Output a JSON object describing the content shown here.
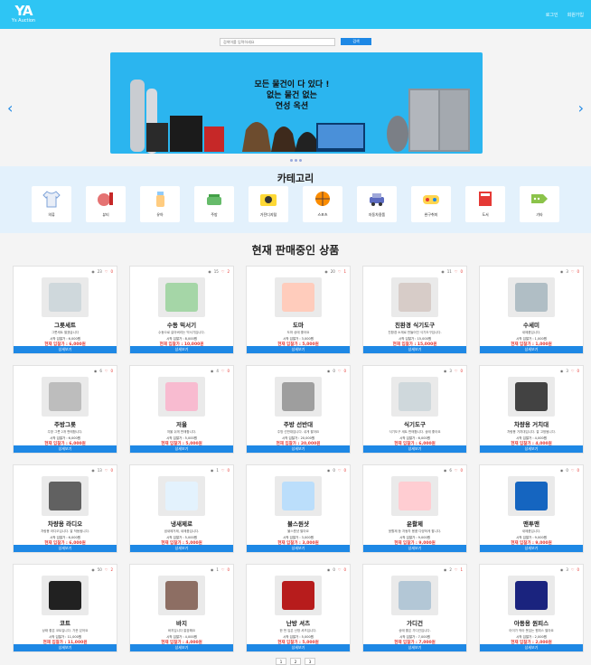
{
  "header": {
    "logo_mark": "YA",
    "logo_text": "Ys Auction",
    "login": "로그인",
    "signup": "회원가입"
  },
  "search": {
    "placeholder": "검색어를 입력하세요",
    "button": "검색"
  },
  "banner": {
    "line1": "모든 물건이 다 있다 !",
    "line2": "없는 물건 없는",
    "line3": "연성 옥션"
  },
  "categories": {
    "title": "카테고리",
    "items": [
      {
        "label": "의류",
        "icon": "shirt-icon"
      },
      {
        "label": "뷰티",
        "icon": "makeup-icon"
      },
      {
        "label": "유아",
        "icon": "baby-bottle-icon"
      },
      {
        "label": "주방",
        "icon": "pot-icon"
      },
      {
        "label": "가전디지털",
        "icon": "camera-icon"
      },
      {
        "label": "스포츠",
        "icon": "basketball-icon"
      },
      {
        "label": "자동차용품",
        "icon": "car-icon"
      },
      {
        "label": "완구취미",
        "icon": "gamepad-icon"
      },
      {
        "label": "도서",
        "icon": "book-icon"
      },
      {
        "label": "기타",
        "icon": "tag-icon"
      }
    ]
  },
  "products": {
    "title": "현재 판매중인 상품",
    "detail_label": "상세보기",
    "items": [
      {
        "name": "그릇세트",
        "desc": "그릇세트 팔겠습니다",
        "views": "23",
        "likes": "0",
        "start": "시작 입찰가 : 6,000원",
        "current": "현재 입찰가 : 6,000원"
      },
      {
        "name": "수동 믹서기",
        "desc": "수동으로 갈아버리는 믹서기입니다.",
        "views": "15",
        "likes": "2",
        "start": "시작 입찰가 : 8,000원",
        "current": "현재 입찰가 : 10,000원"
      },
      {
        "name": "도마",
        "desc": "도마 상태 좋아요",
        "views": "20",
        "likes": "1",
        "start": "시작 입찰가 : 3,000원",
        "current": "현재 입찰가 : 5,000원"
      },
      {
        "name": "친환경 식기도구",
        "desc": "친환경 소재로 만들어진 식기도구입니다.",
        "views": "11",
        "likes": "0",
        "start": "시작 입찰가 : 15,000원",
        "current": "현재 입찰가 : 15,000원"
      },
      {
        "name": "수세미",
        "desc": "새제품입니다.",
        "views": "3",
        "likes": "0",
        "start": "시작 입찰가 : 1,000원",
        "current": "현재 입찰가 : 1,000원"
      },
      {
        "name": "주방그릇",
        "desc": "주방 그릇 2개 판매합니다.",
        "views": "6",
        "likes": "0",
        "start": "시작 입찰가 : 6,000원",
        "current": "현재 입찰가 : 6,000원"
      },
      {
        "name": "저울",
        "desc": "저울 쉬게 판매합니다.",
        "views": "4",
        "likes": "0",
        "start": "시작 입찰가 : 5,000원",
        "current": "현재 입찰가 : 5,000원"
      },
      {
        "name": "주방 선반대",
        "desc": "주방 선반대입니다. 쉬게 팔아요",
        "views": "0",
        "likes": "0",
        "start": "시작 입찰가 : 20,000원",
        "current": "현재 입찰가 : 20,000원"
      },
      {
        "name": "식기도구",
        "desc": "식기도구 세트 판매합니다. 상태 좋아요",
        "views": "3",
        "likes": "0",
        "start": "시작 입찰가 : 6,000원",
        "current": "현재 입찰가 : 6,000원"
      },
      {
        "name": "차량용 거치대",
        "desc": "차량용 거치대입니다. 잘 고정됩니다.",
        "views": "3",
        "likes": "0",
        "start": "시작 입찰가 : 4,000원",
        "current": "현재 입찰가 : 4,000원"
      },
      {
        "name": "차량용 라디오",
        "desc": "차량용 라디오입니다. 잘 작동됩니다.",
        "views": "13",
        "likes": "0",
        "start": "시작 입찰가 : 6,000원",
        "current": "현재 입찰가 : 6,000원"
      },
      {
        "name": "냉새제로",
        "desc": "냄새제거제, 새제품입니다.",
        "views": "1",
        "likes": "0",
        "start": "시작 입찰가 : 5,000원",
        "current": "현재 입찰가 : 5,000원"
      },
      {
        "name": "불스원샷",
        "desc": "불스원샷 팔아요",
        "views": "0",
        "likes": "0",
        "start": "시작 입찰가 : 3,000원",
        "current": "현재 입찰가 : 3,000원"
      },
      {
        "name": "윤활제",
        "desc": "윤활제 등 자동차 용품 다양하게 팝니다.",
        "views": "6",
        "likes": "0",
        "start": "시작 입찰가 : 9,000원",
        "current": "현재 입찰가 : 9,000원"
      },
      {
        "name": "맨투맨",
        "desc": "새제품입니다.",
        "views": "0",
        "likes": "0",
        "start": "시작 입찰가 : 9,000원",
        "current": "현재 입찰가 : 9,000원"
      },
      {
        "name": "코트",
        "desc": "상태 좋은 코트입니다. 가운 있어요",
        "views": "50",
        "likes": "2",
        "start": "시작 입찰가 : 11,000원",
        "current": "현재 입찰가 : 11,000원"
      },
      {
        "name": "바지",
        "desc": "바지입니다 깔끔해요",
        "views": "1",
        "likes": "0",
        "start": "시작 입찰가 : 4,000원",
        "current": "현재 입찰가 : 4,000원"
      },
      {
        "name": "난방 셔츠",
        "desc": "한 번 입은 난방 셔츠입니다.",
        "views": "0",
        "likes": "0",
        "start": "시작 입찰가 : 5,000원",
        "current": "현재 입찰가 : 5,000원"
      },
      {
        "name": "가디건",
        "desc": "상태 좋은 가디건입니다.",
        "views": "2",
        "likes": "1",
        "start": "시작 입찰가 : 7,000원",
        "current": "현재 입찰가 : 7,000원"
      },
      {
        "name": "아동용 원피스",
        "desc": "아이가 작아 못입는 원피스 팔아요",
        "views": "3",
        "likes": "0",
        "start": "시작 입찰가 : 2,000원",
        "current": "현재 입찰가 : 2,000원"
      }
    ]
  },
  "pagination": [
    "1",
    "2",
    "3"
  ]
}
